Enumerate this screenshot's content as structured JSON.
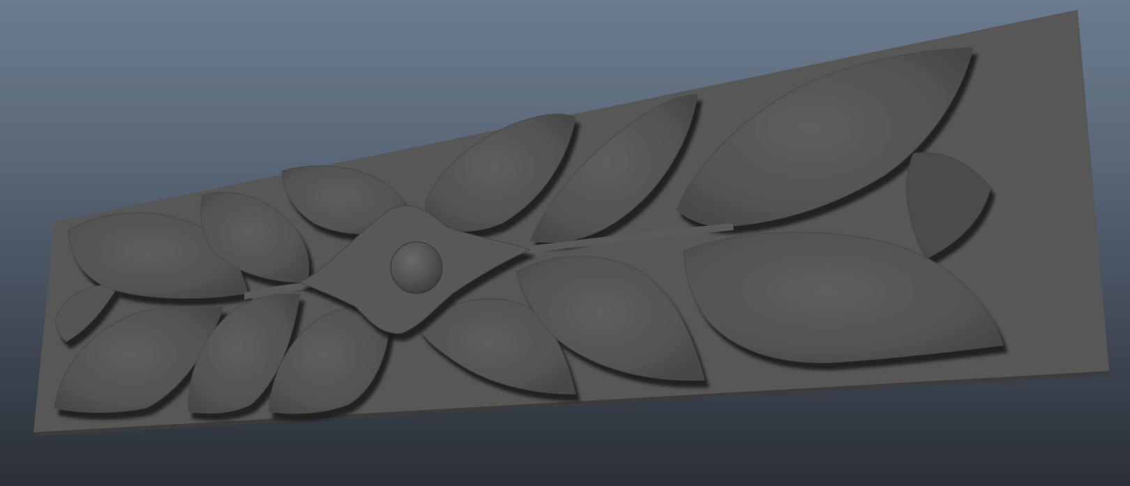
{
  "viewport": {
    "background_top": "#6b7b8e",
    "background_bottom": "#2a2f37"
  },
  "model": {
    "plaque_color": "#565656",
    "relief_color": "#535353",
    "shadow_color": "#1e1e1e"
  }
}
